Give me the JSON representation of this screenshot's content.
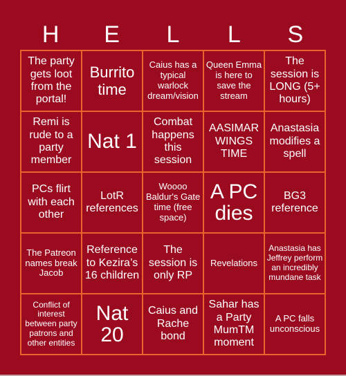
{
  "title_letters": [
    "H",
    "E",
    "L",
    "L",
    "S"
  ],
  "colors": {
    "background": "#9B0B20",
    "border": "#E8642A",
    "text": "#FFFFFF"
  },
  "cells": [
    {
      "text": "The party gets loot from the portal!",
      "size": "md"
    },
    {
      "text": "Burrito time",
      "size": "lg"
    },
    {
      "text": "Caius has a typical warlock dream/vision",
      "size": "sm"
    },
    {
      "text": "Queen Emma is here to save the stream",
      "size": "sm"
    },
    {
      "text": "The session is LONG (5+ hours)",
      "size": "md"
    },
    {
      "text": "Remi is rude to a party member",
      "size": "md"
    },
    {
      "text": "Nat 1",
      "size": "xl"
    },
    {
      "text": "Combat happens this session",
      "size": "md"
    },
    {
      "text": "AASIMAR WINGS TIME",
      "size": "md"
    },
    {
      "text": "Anastasia modifies a spell",
      "size": "md"
    },
    {
      "text": "PCs flirt with each other",
      "size": "md"
    },
    {
      "text": "LotR references",
      "size": "md"
    },
    {
      "text": "Woooo Baldur's Gate time (free space)",
      "size": "sm"
    },
    {
      "text": "A PC dies",
      "size": "xl"
    },
    {
      "text": "BG3 reference",
      "size": "md"
    },
    {
      "text": "The Patreon names break Jacob",
      "size": "sm"
    },
    {
      "text": "Reference to Kezira’s 16 children",
      "size": "md"
    },
    {
      "text": "The session is only RP",
      "size": "md"
    },
    {
      "text": "Revelations",
      "size": "sm"
    },
    {
      "text": "Anastasia has Jeffrey perform an incredibly mundane task",
      "size": "xs"
    },
    {
      "text": "Conflict of interest between party patrons and other entities",
      "size": "xs"
    },
    {
      "text": "Nat 20",
      "size": "xl"
    },
    {
      "text": "Caius and Rache bond",
      "size": "md"
    },
    {
      "text": "Sahar has a Party MumTM moment",
      "size": "md"
    },
    {
      "text": "A PC falls unconscious",
      "size": "sm"
    }
  ]
}
